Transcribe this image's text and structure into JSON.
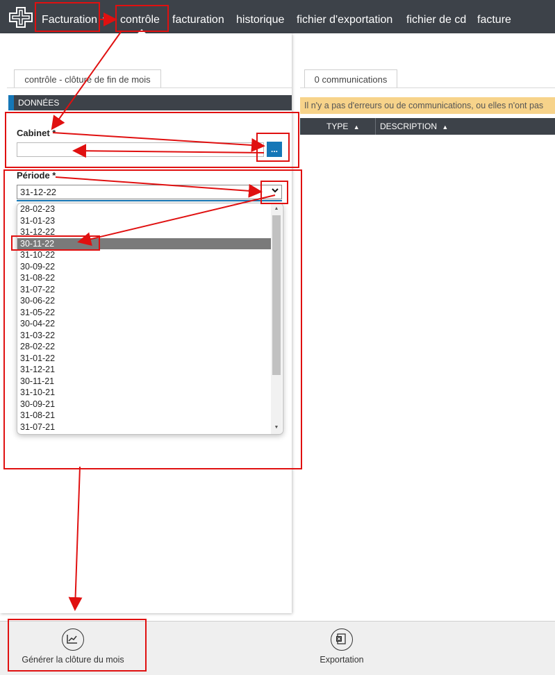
{
  "nav": {
    "app_menu": "Facturation",
    "items": [
      "contrôle",
      "facturation",
      "historique",
      "fichier d'exportation",
      "fichier de cd",
      "facture"
    ]
  },
  "left": {
    "tab_label": "contrôle - clôture de fin de mois",
    "section_title": "DONNÉES",
    "cabinet_label": "Cabinet *",
    "cabinet_value": "",
    "cabinet_button": "...",
    "periode_label": "Période *",
    "periode_selected": "31-12-22",
    "periode_options": [
      "28-02-23",
      "31-01-23",
      "31-12-22",
      "30-11-22",
      "31-10-22",
      "30-09-22",
      "31-08-22",
      "31-07-22",
      "30-06-22",
      "31-05-22",
      "30-04-22",
      "31-03-22",
      "28-02-22",
      "31-01-22",
      "31-12-21",
      "30-11-21",
      "31-10-21",
      "30-09-21",
      "31-08-21",
      "31-07-21"
    ],
    "highlighted_option": "30-11-22"
  },
  "right": {
    "tab_label": "0 communications",
    "warning": "Il n'y a pas d'erreurs ou de communications, ou elles n'ont pas",
    "columns": [
      "TYPE",
      "DESCRIPTION"
    ]
  },
  "bottom": {
    "generate_label": "Générer la clôture du mois",
    "export_label": "Exportation"
  },
  "colors": {
    "nav_bg": "#3d4249",
    "accent_blue": "#1577b7",
    "warning_bg": "#f7d38a",
    "annotation_red": "#e01010"
  }
}
